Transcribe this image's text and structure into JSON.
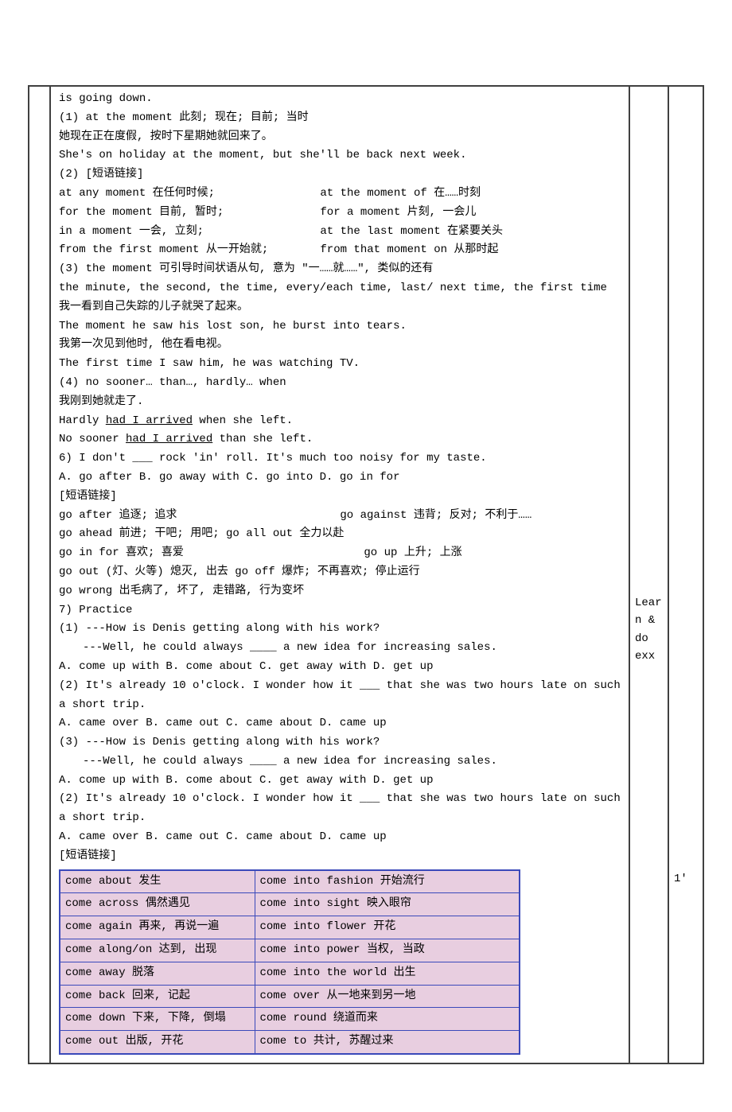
{
  "top": {
    "l1": "is going down.",
    "l2": "(1) at the moment  此刻; 现在; 目前; 当时",
    "l3": "她现在正在度假, 按时下星期她就回来了。",
    "l4": "She's on holiday at the moment, but she'll be back next week.",
    "l5": "(2) [短语链接]"
  },
  "phrases1": {
    "r1a": "at any moment 在任何时候;",
    "r1b": "at the moment of 在……时刻",
    "r2a": "for the moment 目前, 暂时;",
    "r2b": "for a moment 片刻, 一会儿",
    "r3a": "in a moment 一会, 立刻;",
    "r3b": "at the last moment 在紧要关头",
    "r4a": "from the first moment 从一开始就;",
    "r4b": "from that moment on 从那时起"
  },
  "block3": {
    "l1": "(3) the moment 可引导时间状语从句, 意为 \"一……就……\", 类似的还有",
    "l2": " the minute, the second, the time, every/each time, last/ next time, the first time",
    "l3": "我一看到自己失踪的儿子就哭了起来。",
    "l4": "The moment he saw his lost son, he burst into tears.",
    "l5": "我第一次见到他时,  他在看电视。",
    "l6": "The first time I saw him, he was watching TV.",
    "l7": "(4) no sooner… than…, hardly… when",
    "l8": "我刚到她就走了.",
    "l9a": "Hardly ",
    "l9b": "had I arrived",
    "l9c": " when she left.",
    "l10a": "No sooner ",
    "l10b": "had I arrived",
    "l10c": " than she left."
  },
  "block6": {
    "l1": "6) I don't ___ rock  'in'  roll. It's much too noisy for my taste.",
    "l2": "A. go after  B. go away with  C. go into  D. go in for",
    "l3": "[短语链接]"
  },
  "goPhrases": {
    "r1a": "go after 追逐; 追求",
    "r1b": "go against 违背; 反对; 不利于……",
    "r2a": "go ahead 前进; 干吧; 用吧;    go all out 全力以赴",
    "r3a": "go in for 喜欢; 喜爱",
    "r3b": "go up 上升; 上涨",
    "r4": "go out (灯、火等) 熄灭, 出去  go off 爆炸; 不再喜欢; 停止运行",
    "r5": "go wrong 出毛病了, 坏了, 走错路, 行为变坏"
  },
  "practice": {
    "head": "7) Practice",
    "q1a": "(1) ---How is Denis getting along with his work?",
    "q1b": "---Well, he could always ____ a new idea for increasing sales.",
    "q1opts": "A. come up with    B. come about  C. get away with   D. get up",
    "q2a": "(2) It's already 10 o'clock. I wonder how it ___ that she was two hours late on such a short trip.",
    "q2opts": "A. came over    B. came out    C. came about   D. came up",
    "q3a": "(3) ---How is Denis getting along with his work?",
    "q3b": "---Well, he could always ____ a new idea for increasing sales.",
    "q3opts": "A. come up with    B. come about  C. get away with   D. get up",
    "q4a": "(2) It's already 10 o'clock. I wonder how it ___ that she was two hours late on such a short trip.",
    "q4opts": "A. came over    B. came out    C. came about   D. came up",
    "link": "[短语链接]"
  },
  "comeTable": [
    {
      "a": "come about 发生",
      "b": "come into fashion 开始流行"
    },
    {
      "a": "come across 偶然遇见",
      "b": "come into sight 映入眼帘"
    },
    {
      "a": "come again 再来, 再说一遍",
      "b": "come into flower 开花"
    },
    {
      "a": "come along/on 达到, 出现",
      "b": "come into power 当权, 当政"
    },
    {
      "a": "come away 脱落",
      "b": "come into the world 出生"
    },
    {
      "a": "come back 回来, 记起",
      "b": "come over 从一地来到另一地"
    },
    {
      "a": "come down 下来, 下降, 倒塌",
      "b": "come round 绕道而来"
    },
    {
      "a": "come out 出版, 开花",
      "b": "come to 共计, 苏醒过来"
    }
  ],
  "notes": {
    "n1a": "Lear",
    "n1b": "n  &",
    "n1c": "do",
    "n1d": "exx",
    "n2": "1'"
  }
}
